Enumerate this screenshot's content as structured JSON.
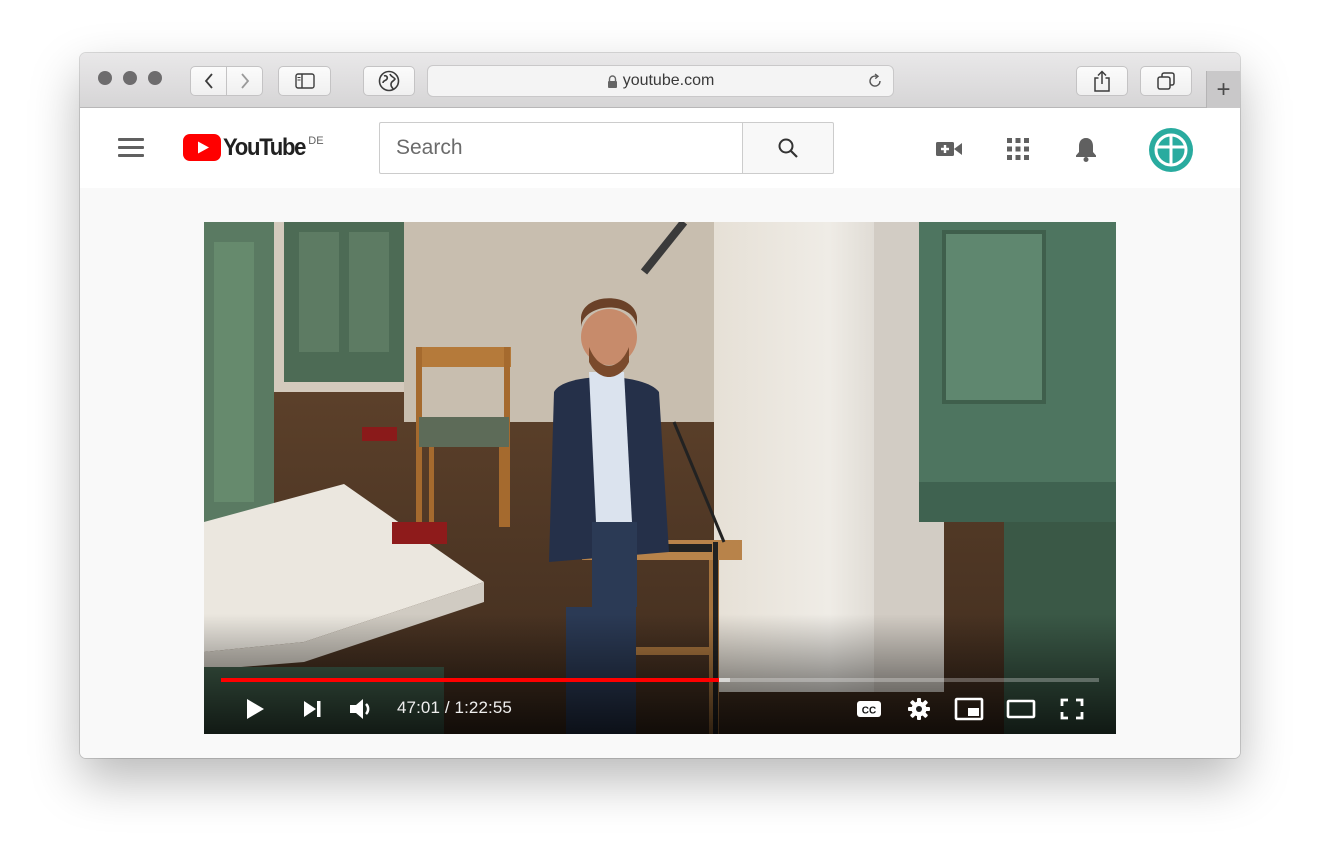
{
  "browser": {
    "address": "youtube.com",
    "new_tab_label": "+",
    "icons": [
      "back-icon",
      "forward-icon",
      "sidebar-icon",
      "globe-icon",
      "lock-icon",
      "reload-icon",
      "share-icon",
      "tabs-icon"
    ]
  },
  "header": {
    "logo_word": "YouTube",
    "region": "DE",
    "search_placeholder": "Search",
    "icons": [
      "hamburger-icon",
      "search-icon",
      "create-video-icon",
      "apps-grid-icon",
      "bell-icon",
      "avatar-cross-icon"
    ],
    "avatar_color": "#29ab9f"
  },
  "player": {
    "time": "47:01 / 1:22:55",
    "progress_fraction": 0.567,
    "buffered_fraction": 0.58,
    "progress_color": "#ff0000",
    "controls": [
      "play-icon",
      "next-icon",
      "volume-icon",
      "cc-icon",
      "settings-gear-icon",
      "miniplayer-icon",
      "theater-mode-icon",
      "fullscreen-icon"
    ],
    "cc_label": "CC"
  }
}
